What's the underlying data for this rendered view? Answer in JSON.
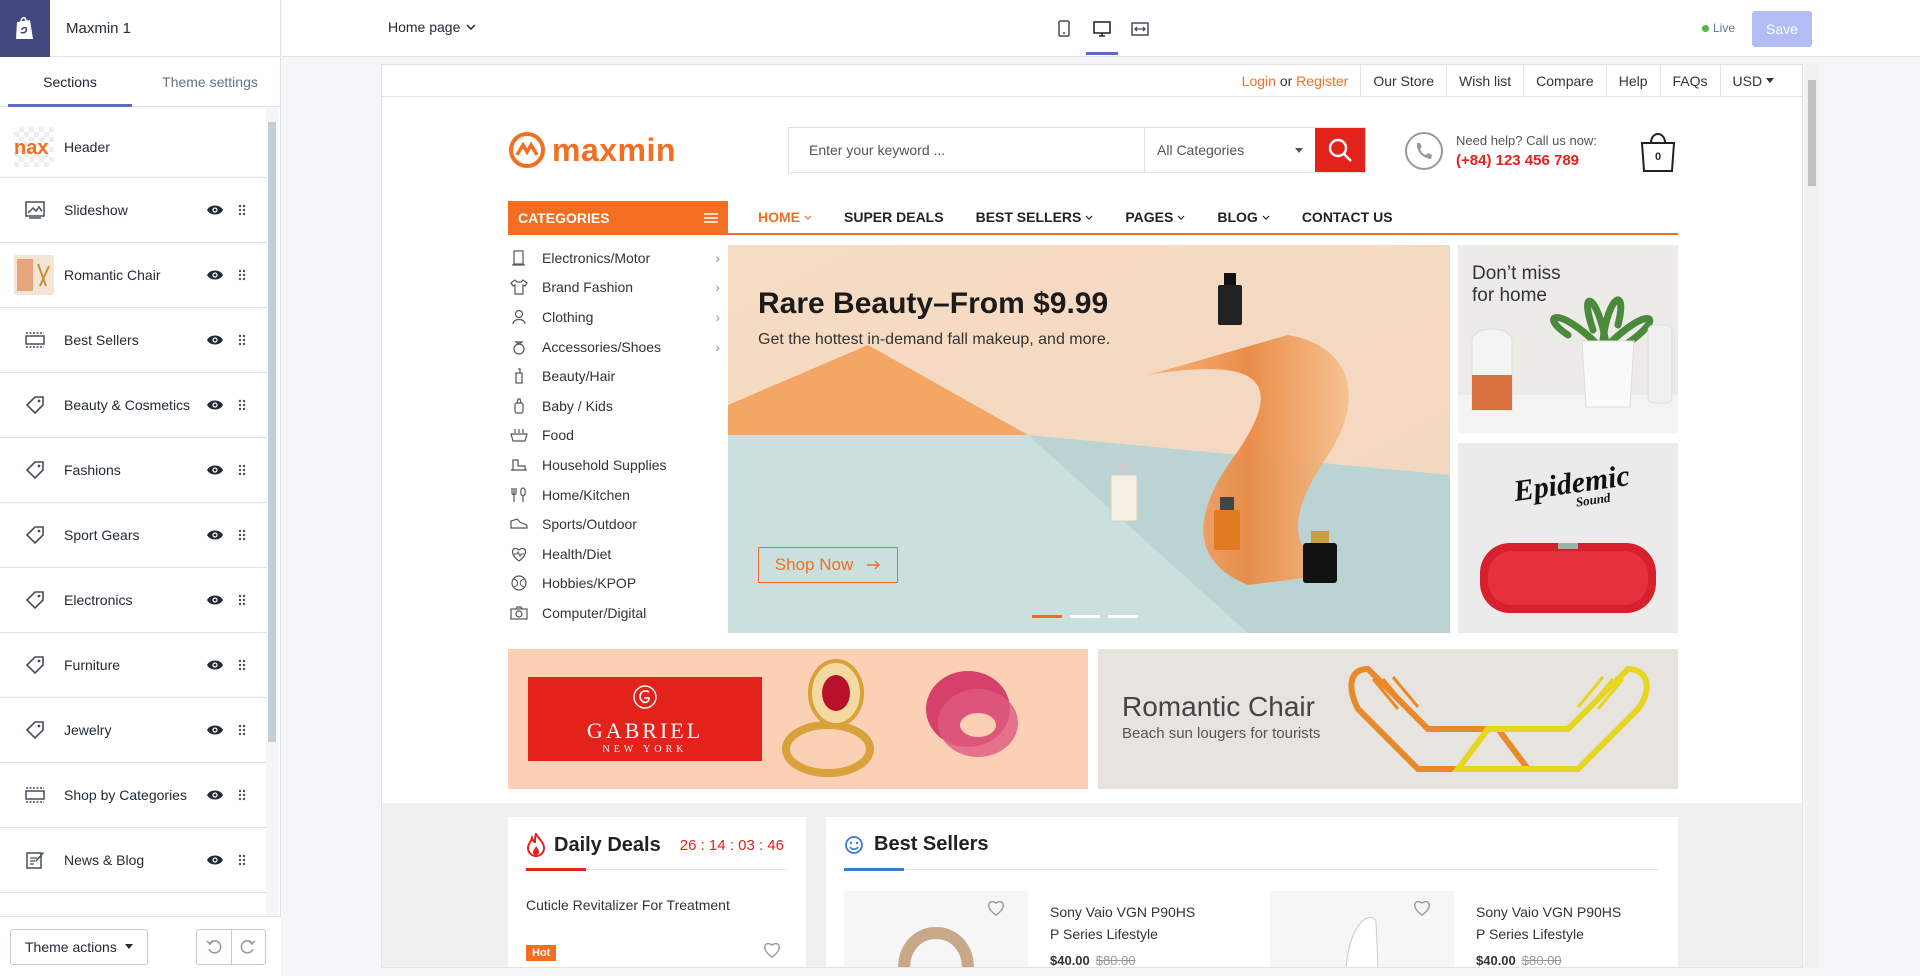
{
  "editor": {
    "store_name": "Maxmin 1",
    "tabs": [
      "Sections",
      "Theme settings"
    ],
    "header_section": "Header",
    "sections": [
      {
        "label": "Slideshow",
        "icon": "slideshow-icon"
      },
      {
        "label": "Romantic Chair",
        "icon": "thumbnail"
      },
      {
        "label": "Best Sellers",
        "icon": "collection-icon"
      },
      {
        "label": "Beauty & Cosmetics",
        "icon": "tag-icon"
      },
      {
        "label": "Fashions",
        "icon": "tag-icon"
      },
      {
        "label": "Sport Gears",
        "icon": "tag-icon"
      },
      {
        "label": "Electronics",
        "icon": "tag-icon"
      },
      {
        "label": "Furniture",
        "icon": "tag-icon"
      },
      {
        "label": "Jewelry",
        "icon": "tag-icon"
      },
      {
        "label": "Shop by Categories",
        "icon": "collection-icon"
      },
      {
        "label": "News & Blog",
        "icon": "blog-icon"
      }
    ],
    "theme_actions": "Theme actions",
    "page_selector": "Home page",
    "live_label": "Live",
    "save_label": "Save",
    "accent": "#5c6ac4"
  },
  "store": {
    "util_links": {
      "login": "Login",
      "or": "or",
      "register": "Register",
      "links": [
        "Our Store",
        "Wish list",
        "Compare",
        "Help",
        "FAQs"
      ],
      "currency": "USD"
    },
    "brand": "maxmin",
    "search_placeholder": "Enter your keyword ...",
    "search_category": "All Categories",
    "help_text": "Need help? Call us now:",
    "phone": "(+84) 123 456 789",
    "cart_count": "0",
    "categories_label": "CATEGORIES",
    "nav": [
      "HOME",
      "SUPER DEALS",
      "BEST SELLERS",
      "PAGES",
      "BLOG",
      "CONTACT US"
    ],
    "category_items": [
      "Electronics/Motor",
      "Brand Fashion",
      "Clothing",
      "Accessories/Shoes",
      "Beauty/Hair",
      "Baby / Kids",
      "Food",
      "Household Supplies",
      "Home/Kitchen",
      "Sports/Outdoor",
      "Health/Diet",
      "Hobbies/KPOP",
      "Computer/Digital"
    ],
    "slide_title": "Rare Beauty–From $9.99",
    "slide_sub": "Get the hottest in-demand fall makeup, and more.",
    "shop_now": "Shop Now",
    "side_banner_text": "Don’t miss for home",
    "epidemic_text": "Epidemic",
    "epidemic_sub": "Sound",
    "gabriel": "GABRIEL",
    "gabriel_sub": "NEW YORK",
    "romantic_title": "Romantic Chair",
    "romantic_sub": "Beach sun lougers for tourists",
    "daily_deals": "Daily Deals",
    "timer": "26 : 14 : 03 : 46",
    "deal_product": "Cuticle Revitalizer For Treatment",
    "hot_label": "Hot",
    "best_sellers": "Best Sellers",
    "best_products": [
      {
        "name": "Sony Vaio VGN P90HS P Series Lifestyle",
        "price": "$40.00",
        "old": "$80.00"
      },
      {
        "name": "Sony Vaio VGN P90HS P Series Lifestyle",
        "price": "$40.00",
        "old": "$80.00"
      }
    ],
    "brand_color": "#f36e21",
    "red": "#e3221b"
  }
}
